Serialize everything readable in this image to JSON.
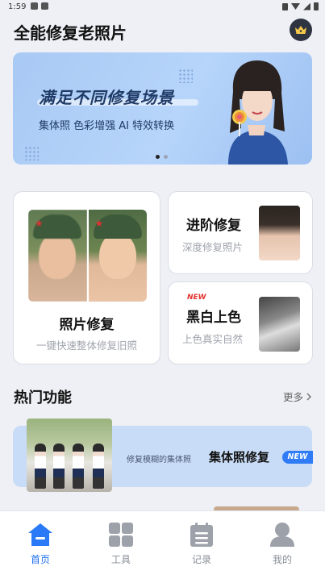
{
  "status_bar": {
    "time": "1:59"
  },
  "header": {
    "title": "全能修复老照片",
    "vip_icon": "crown-icon"
  },
  "banner": {
    "headline": "满足不同修复场景",
    "subline": "集体照  色彩增强  AI 特效转换",
    "page_index": 1,
    "page_count": 2
  },
  "cards": {
    "photo_repair": {
      "title": "照片修复",
      "desc": "一键快速整体修复旧照"
    },
    "advanced_repair": {
      "title": "进阶修复",
      "desc": "深度修复照片"
    },
    "colorize": {
      "tag": "NEW",
      "title": "黑白上色",
      "desc": "上色真实自然"
    }
  },
  "hot_section": {
    "title": "热门功能",
    "more": "更多",
    "items": [
      {
        "desc": "修复模糊的集体照",
        "name": "集体照修复",
        "tag": "NEW"
      }
    ]
  },
  "tabbar": {
    "items": [
      {
        "label": "首页",
        "icon": "home-icon",
        "active": true
      },
      {
        "label": "工具",
        "icon": "grid-icon",
        "active": false
      },
      {
        "label": "记录",
        "icon": "notes-icon",
        "active": false
      },
      {
        "label": "我的",
        "icon": "user-icon",
        "active": false
      }
    ]
  },
  "colors": {
    "accent": "#1e6ff0",
    "new_tag_red": "#e2322d",
    "new_tag_blue": "#2f7cf6",
    "banner_bg": "#b7d5fa"
  }
}
